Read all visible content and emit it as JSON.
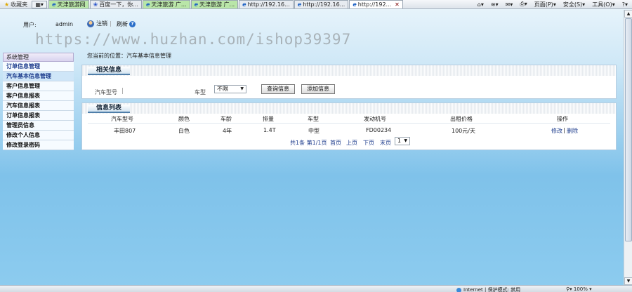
{
  "browser": {
    "favorites": "收藏夹",
    "tabs": [
      {
        "label": "天津旅游网",
        "style": "green"
      },
      {
        "label": "百度一下，你...",
        "style": "grey"
      },
      {
        "label": "天津旅游 广...",
        "style": "green"
      },
      {
        "label": "天津旅游 广...",
        "style": "green"
      },
      {
        "label": "http://192.16...",
        "style": "grey"
      },
      {
        "label": "http://192.16...",
        "style": "grey"
      },
      {
        "label": "http://192...",
        "style": "active"
      }
    ],
    "tools": {
      "page": "页面(P)",
      "safety": "安全(S)",
      "tools": "工具(O)"
    }
  },
  "header": {
    "user_label": "用户:",
    "user_name": "admin",
    "logout": "注销",
    "refresh": "刷新"
  },
  "watermark": "https://www.huzhan.com/ishop39397",
  "sidebar": {
    "heading": "系统管理",
    "items": [
      "订单信息管理",
      "汽车基本信息管理",
      "客户信息管理",
      "客户信息报表",
      "汽车信息报表",
      "订单信息报表",
      "管理员信息",
      "修改个人信息",
      "修改登录密码"
    ]
  },
  "breadcrumb": "您当前的位置：汽车基本信息管理",
  "search_panel": {
    "title": "相关信息",
    "model_label": "汽车型号",
    "model_value": "",
    "type_label": "车型",
    "type_selected": "不限",
    "query_button": "查询信息",
    "add_button": "添加信息"
  },
  "list_panel": {
    "title": "信息列表",
    "columns": [
      "汽车型号",
      "颜色",
      "车龄",
      "排量",
      "车型",
      "发动机号",
      "出租价格",
      "操作"
    ],
    "rows": [
      {
        "model": "丰田807",
        "color": "白色",
        "age": "4年",
        "displacement": "1.4T",
        "type": "中型",
        "engine": "FD00234",
        "price": "100元/天",
        "edit": "修改",
        "delete": "删除"
      }
    ],
    "pager": {
      "info": "共1条 第1/1页",
      "first": "首页",
      "prev": "上页",
      "next": "下页",
      "last": "末页",
      "page_select": "1"
    }
  },
  "statusbar": {
    "zone": "Internet | 保护模式: 禁用",
    "zoom": "100%"
  }
}
